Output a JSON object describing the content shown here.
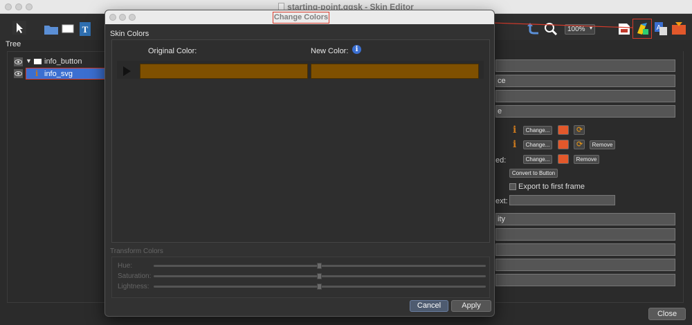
{
  "window": {
    "title": "starting-point.ggsk - Skin Editor"
  },
  "toolbar": {
    "zoom": "100%",
    "tree_label": "Tree",
    "icons": [
      "pointer-icon",
      "folder-icon",
      "rectangle-icon",
      "text-icon",
      "undo-icon",
      "zoom-icon",
      "skin-colors-icon",
      "translate-icon",
      "export-icon"
    ]
  },
  "tree": {
    "items": [
      {
        "label": "info_button"
      },
      {
        "label": "info_svg"
      }
    ]
  },
  "right_panel": {
    "fields": [
      "",
      "ce",
      "",
      "e"
    ],
    "change_label": "Change...",
    "remove_label": "Remove",
    "row3_label": "ed:",
    "convert_button": "Convert to Button",
    "export_first_frame": "Export to first frame",
    "text_label": "ext:",
    "lower_fields": [
      "ity",
      "",
      "",
      "",
      ""
    ]
  },
  "footer": {
    "close_label": "Close"
  },
  "dialog": {
    "title": "Change Colors",
    "skin_colors_label": "Skin Colors",
    "original_color_label": "Original Color:",
    "new_color_label": "New Color:",
    "info_glyph": "i",
    "colors": [
      {
        "original": "#7f5000",
        "new": "#7f5000"
      }
    ],
    "transform_label": "Transform Colors",
    "hue_label": "Hue:",
    "saturation_label": "Saturation:",
    "lightness_label": "Lightness:",
    "hue_value": 0.5,
    "saturation_value": 0.5,
    "lightness_value": 0.5,
    "cancel_label": "Cancel",
    "apply_label": "Apply"
  },
  "colors": {
    "annotation_red": "#d93b2b",
    "selection_blue": "#3b6fd1",
    "swatch_brown": "#7f5000"
  }
}
